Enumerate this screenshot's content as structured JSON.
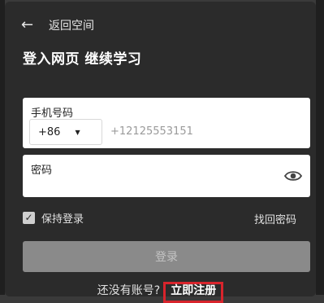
{
  "header": {
    "back_label": "返回空间",
    "title": "登入网页 继续学习"
  },
  "phone": {
    "label": "手机号码",
    "country_code": "+86",
    "placeholder": "+12125553151"
  },
  "password": {
    "label": "密码"
  },
  "options": {
    "keep_signed_in": "保持登录",
    "keep_signed_in_checked": true,
    "forgot_password": "找回密码"
  },
  "login_button": "登录",
  "signup": {
    "prompt": "还没有账号?",
    "link": "立即注册"
  },
  "colors": {
    "highlight_border": "#d8242c",
    "panel_bg": "#2b2b2b"
  }
}
